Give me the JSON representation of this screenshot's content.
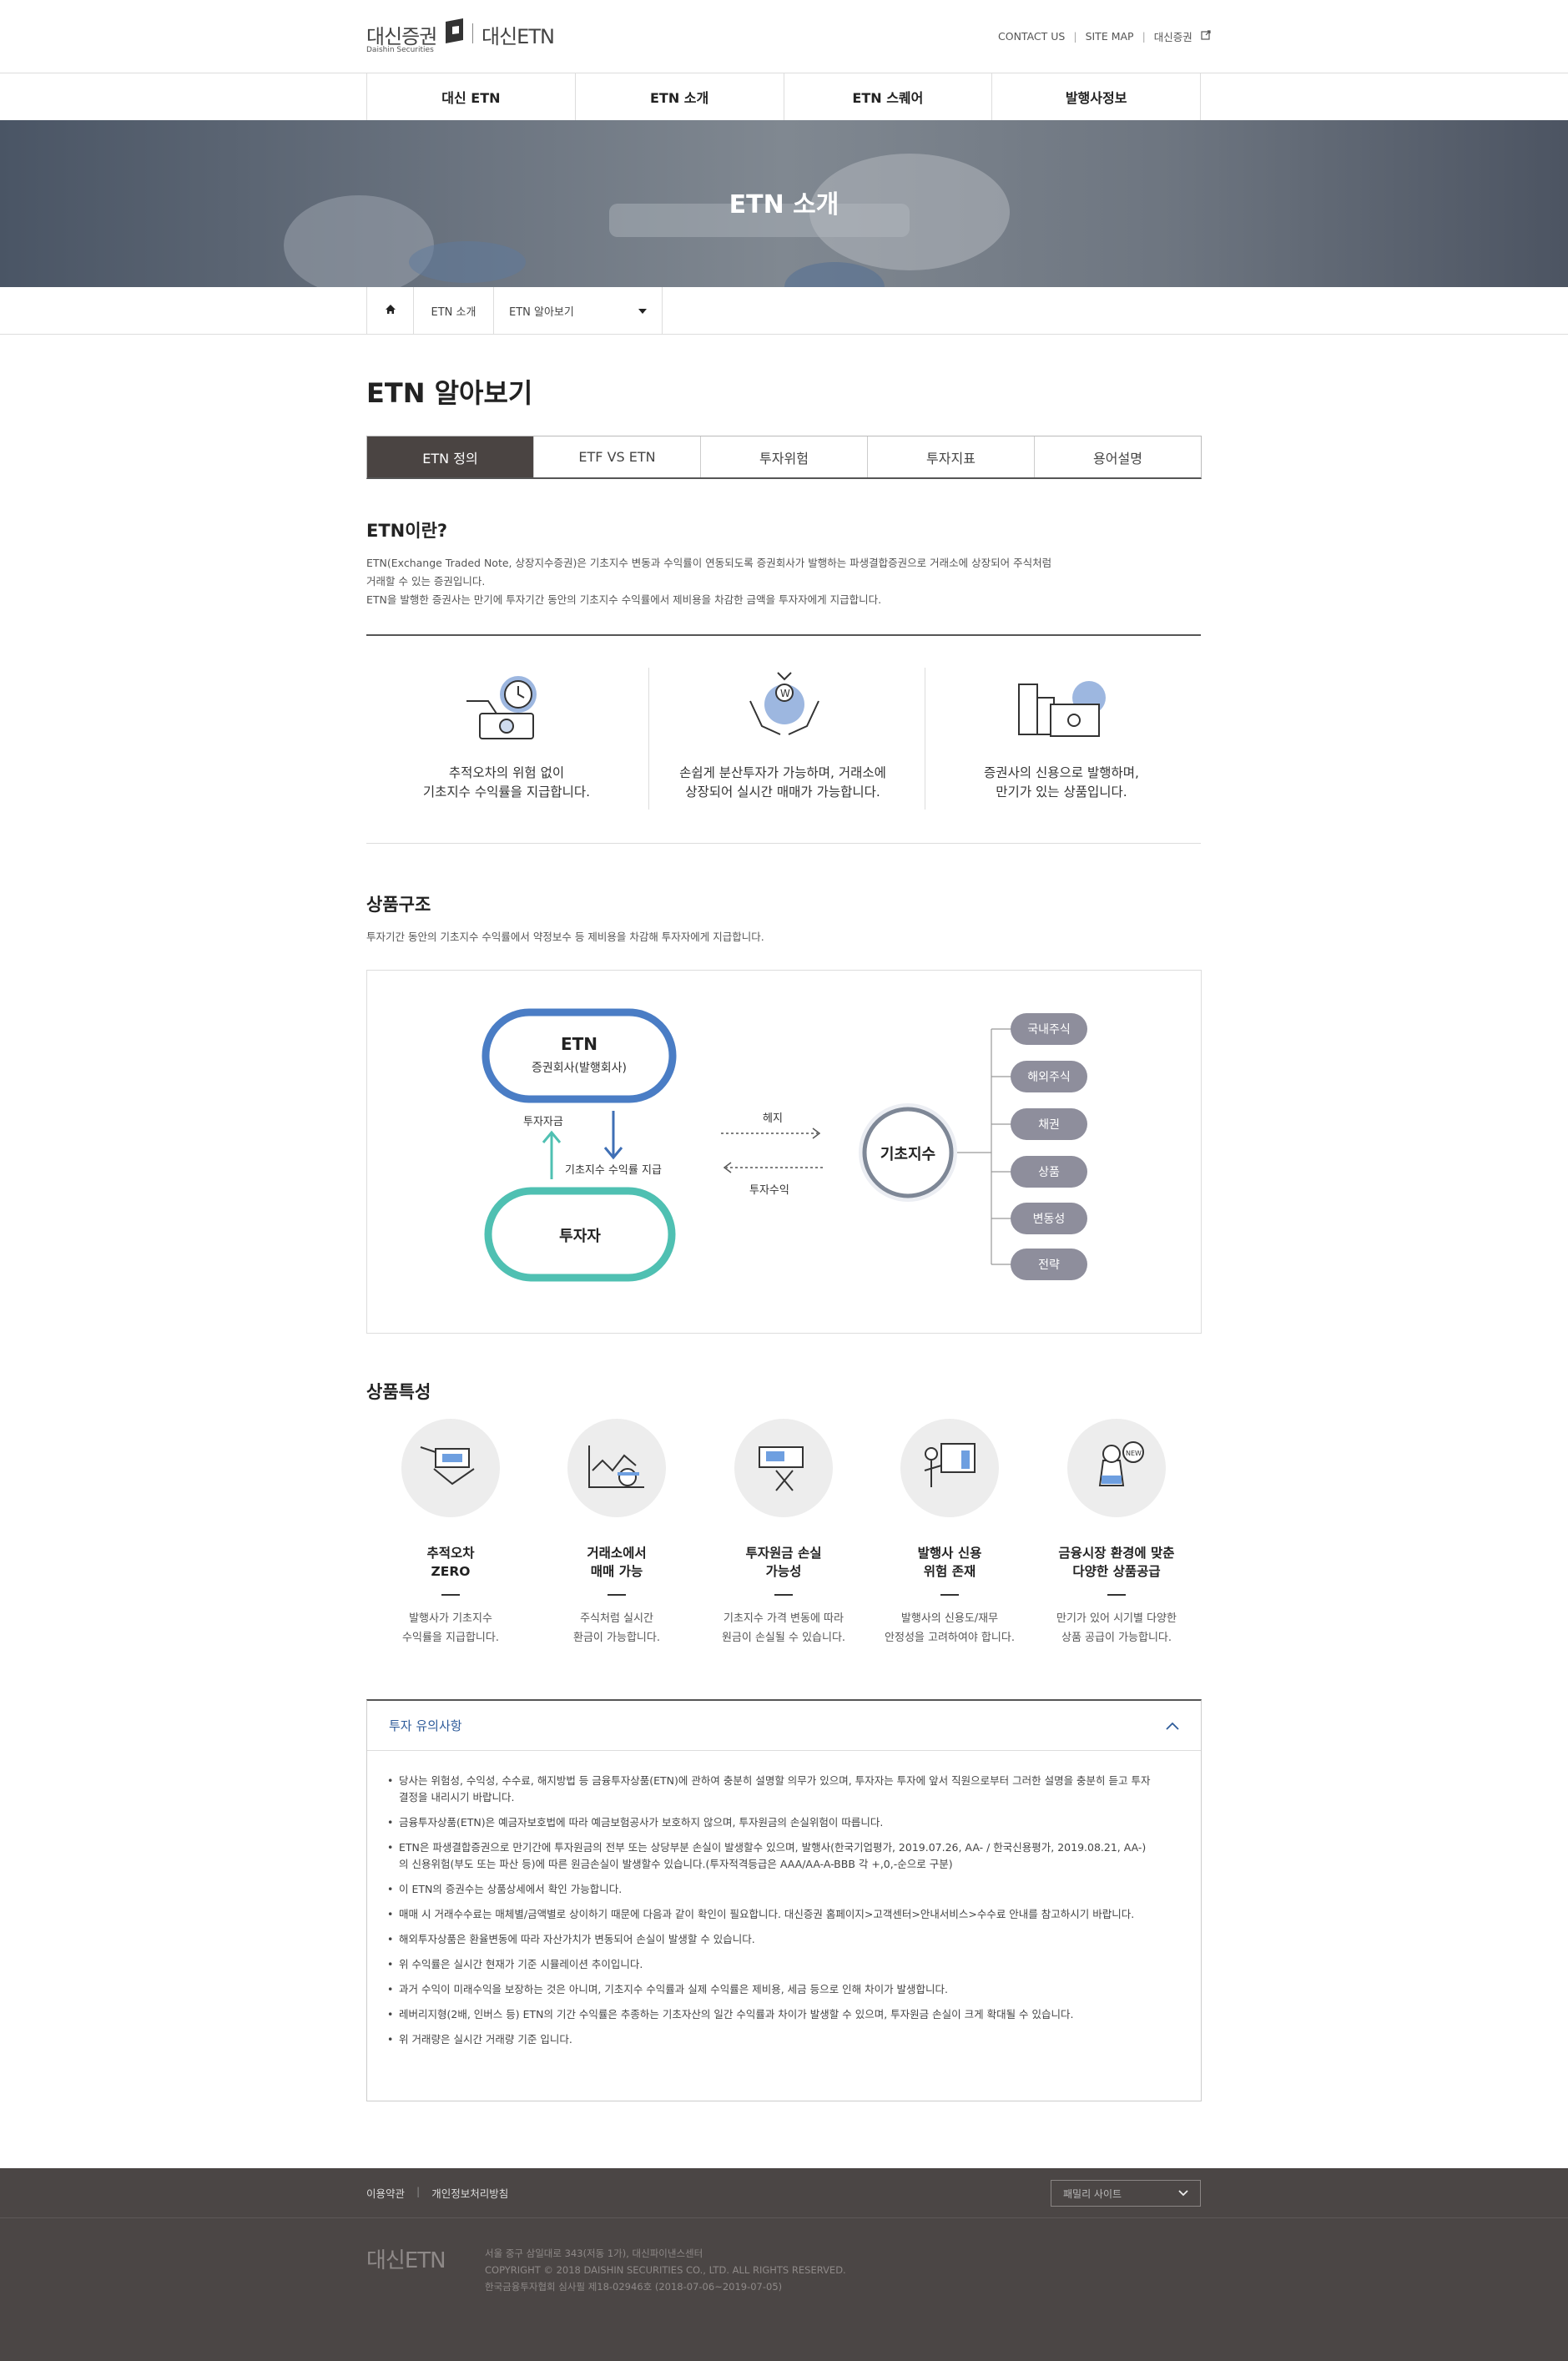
{
  "header": {
    "logo_kr": "대신증권",
    "logo_en": "Daishin Securities",
    "logo_etn": "대신ETN",
    "util": [
      "CONTACT US",
      "SITE MAP",
      "대신증권"
    ]
  },
  "gnb": [
    "대신 ETN",
    "ETN 소개",
    "ETN 스퀘어",
    "발행사정보"
  ],
  "hero": {
    "title": "ETN 소개"
  },
  "breadcrumb": {
    "level1": "ETN 소개",
    "level2": "ETN 알아보기"
  },
  "page_title": "ETN 알아보기",
  "tabs": [
    "ETN 정의",
    "ETF VS ETN",
    "투자위험",
    "투자지표",
    "용어설명"
  ],
  "intro": {
    "heading": "ETN이란?",
    "p1": "ETN(Exchange Traded Note, 상장지수증권)은 기초지수 변동과 수익률이 연동되도록 증권회사가 발행하는 파생결합증권으로 거래소에 상장되어 주식처럼",
    "p1b": "거래할 수 있는 증권입니다.",
    "p2": "ETN을 발행한 증권사는 만기에 투자기간 동안의 기초지수 수익률에서 제비용을 차감한 금액을 투자자에게 지급합니다."
  },
  "features3": [
    {
      "l1": "추적오차의 위험 없이",
      "l2": "기초지수 수익률을 지급합니다."
    },
    {
      "l1": "손쉽게 분산투자가 가능하며, 거래소에",
      "l2": "상장되어 실시간 매매가 가능합니다."
    },
    {
      "l1": "증권사의 신용으로 발행하며,",
      "l2": "만기가 있는 상품입니다."
    }
  ],
  "structure": {
    "heading": "상품구조",
    "desc": "투자기간 동안의 기초지수 수익률에서 약정보수 등 제비용을 차감해 투자자에게 지급합니다.",
    "etn_title": "ETN",
    "etn_sub": "증권회사(발행회사)",
    "investor": "투자자",
    "invest_pay": "투자자금",
    "index_pay": "기초지수 수익률 지급",
    "hedge": "헤지",
    "profit": "투자수익",
    "index": "기초지수",
    "assets": [
      "국내주식",
      "해외주식",
      "채권",
      "상품",
      "변동성",
      "전략"
    ]
  },
  "characteristics": {
    "heading": "상품특성",
    "items": [
      {
        "t1": "추적오차",
        "t2": "ZERO",
        "d1": "발행사가 기초지수",
        "d2": "수익률을 지급합니다."
      },
      {
        "t1": "거래소에서",
        "t2": "매매 가능",
        "d1": "주식처럼 실시간",
        "d2": "환금이 가능합니다."
      },
      {
        "t1": "투자원금 손실",
        "t2": "가능성",
        "d1": "기초지수 가격 변동에 따라",
        "d2": "원금이 손실될 수 있습니다."
      },
      {
        "t1": "발행사 신용",
        "t2": "위험 존재",
        "d1": "발행사의 신용도/재무",
        "d2": "안정성을 고려하여야 합니다."
      },
      {
        "t1": "금융시장 환경에 맞춘",
        "t2": "다양한 상품공급",
        "d1": "만기가 있어 시기별 다양한",
        "d2": "상품 공급이 가능합니다."
      }
    ]
  },
  "notice": {
    "title": "투자 유의사항",
    "items": [
      "당사는 위험성, 수익성, 수수료, 해지방법 등 금융투자상품(ETN)에 관하여 충분히 설명할 의무가 있으며, 투자자는 투자에 앞서 직원으로부터 그러한 설명을 충분히 듣고 투자결정을 내리시기 바랍니다.",
      "금융투자상품(ETN)은 예금자보호법에 따라 예금보험공사가 보호하지 않으며, 투자원금의 손실위험이 따릅니다.",
      "ETN은 파생결합증권으로 만기간에 투자원금의 전부 또는 상당부분 손실이 발생할수 있으며, 발행사(한국기업평가, 2019.07.26, AA- / 한국신용평가, 2019.08.21, AA-)의 신용위험(부도 또는 파산 등)에 따른 원금손실이 발생할수 있습니다.(투자적격등급은 AAA/AA-A-BBB 각 +,0,-순으로 구분)",
      "이 ETN의 증권수는 상품상세에서 확인 가능합니다.",
      "매매 시 거래수수료는 매체별/금액별로 상이하기 때문에 다음과 같이 확인이 필요합니다. 대신증권 홈페이지>고객센터>안내서비스>수수료 안내를 참고하시기 바랍니다.",
      "해외투자상품은 환율변동에 따라 자산가치가 변동되어 손실이 발생할 수 있습니다.",
      "위 수익률은 실시간 현재가 기준 시뮬레이션 추이입니다.",
      "과거 수익이 미래수익을 보장하는 것은 아니며, 기초지수 수익률과 실제 수익률은 제비용, 세금 등으로 인해 차이가 발생합니다.",
      "레버리지형(2배, 인버스 등) ETN의 기간 수익률은 추종하는 기초자산의 일간 수익률과 차이가 발생할 수 있으며, 투자원금 손실이 크게 확대될 수 있습니다.",
      "위 거래량은 실시간 거래량 기준 입니다."
    ]
  },
  "footer": {
    "links": [
      "이용약관",
      "개인정보처리방침"
    ],
    "family": "패밀리 사이트",
    "logo": "대신ETN",
    "addr": "서울 중구 삼일대로 343(저동 1가), 대신파이낸스센터",
    "copy": "COPYRIGHT © 2018 DAISHIN SECURITIES CO., LTD. ALL RIGHTS RESERVED.",
    "review": "한국금융투자협회 심사필 제18-02946호 (2018-07-06~2019-07-05)"
  }
}
